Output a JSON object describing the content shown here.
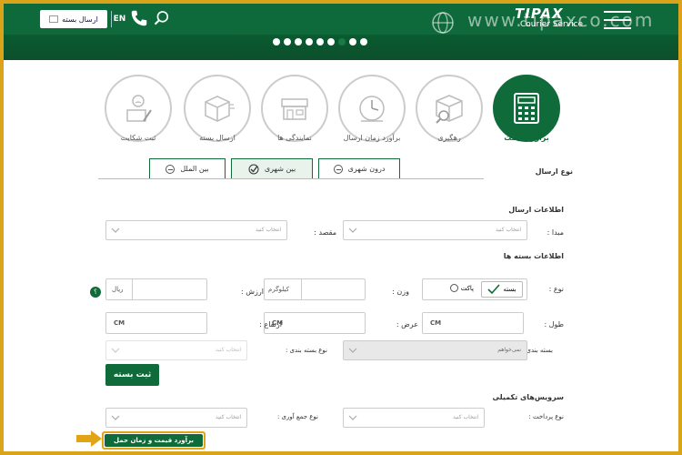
{
  "header": {
    "send_button_label": "ارسال بسته",
    "lang": "EN",
    "site_url": "www.tipaxco.com",
    "logo_text": "TIPAX",
    "logo_subtitle": "Courier Service",
    "slider_dots": 8,
    "active_dot": 6
  },
  "services": [
    {
      "label": "برآورد قیمت",
      "icon": "calculator-icon",
      "active": true
    },
    {
      "label": "رهگیری",
      "icon": "package-search-icon",
      "active": false
    },
    {
      "label": "برآورد زمان ارسال",
      "icon": "clock-icon",
      "active": false
    },
    {
      "label": "نمایندگی ها",
      "icon": "storefront-icon",
      "active": false
    },
    {
      "label": "ارسال بسته",
      "icon": "box-icon",
      "active": false
    },
    {
      "label": "ثبت شکایت",
      "icon": "complaint-icon",
      "active": false
    }
  ],
  "send_type": {
    "label": "نوع ارسال",
    "tabs": [
      {
        "label": "درون شهری",
        "active": false
      },
      {
        "label": "بین شهری",
        "active": true
      },
      {
        "label": "بین الملل",
        "active": false
      }
    ]
  },
  "send_info": {
    "title": "اطلاعات ارسال",
    "origin_label": "مبدا :",
    "origin_placeholder": "انتخاب کنید",
    "dest_label": "مقصد :",
    "dest_placeholder": "انتخاب کنید"
  },
  "package_info": {
    "title": "اطلاعات بسته ها",
    "type_label": "نوع :",
    "type_options": [
      "بسته",
      "پاکت"
    ],
    "type_selected": "بسته",
    "weight_label": "وزن :",
    "weight_unit": "کیلوگرم",
    "value_label": "ارزش :",
    "value_unit": "ریال",
    "badge": "؟",
    "length_label": "طول :",
    "width_label": "عرض :",
    "height_label": "ارتفاع :",
    "cm": "CM",
    "packing_label": "بسته بندی :",
    "packing_value": "نمی‌خواهم",
    "packing_type_label": "نوع بسته بندی :",
    "packing_type_placeholder": "انتخاب کنید",
    "submit_package": "ثبت بسته"
  },
  "extra_services": {
    "title": "سرویس‌های تکمیلی",
    "payment_label": "نوع پرداخت :",
    "payment_placeholder": "انتخاب کنید",
    "pickup_label": "نوع جمع آوری :",
    "pickup_placeholder": "انتخاب کنید",
    "estimate_button": "برآورد قیمت و زمان حمل"
  },
  "colors": {
    "brand": "#0f6b3a",
    "frame": "#d9a41a",
    "highlight": "#e0a416"
  }
}
